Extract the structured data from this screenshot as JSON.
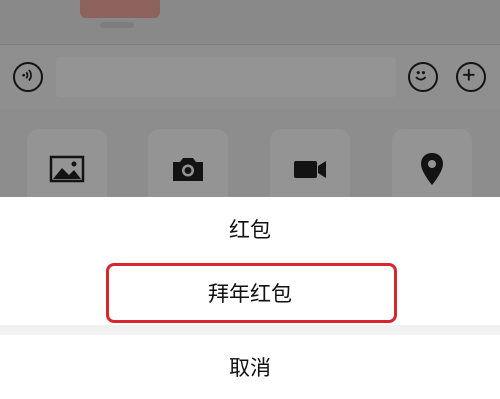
{
  "action_sheet": {
    "options": [
      {
        "label": "红包"
      },
      {
        "label": "拜年红包"
      }
    ],
    "cancel_label": "取消",
    "highlight_color": "#d9262c"
  },
  "chat_input_bar": {
    "left_icon": "voice-icon",
    "right_icons": [
      "emoji-icon",
      "plus-icon"
    ]
  },
  "tool_panel": {
    "icons": [
      "image-icon",
      "camera-icon",
      "video-call-icon",
      "location-icon"
    ]
  }
}
